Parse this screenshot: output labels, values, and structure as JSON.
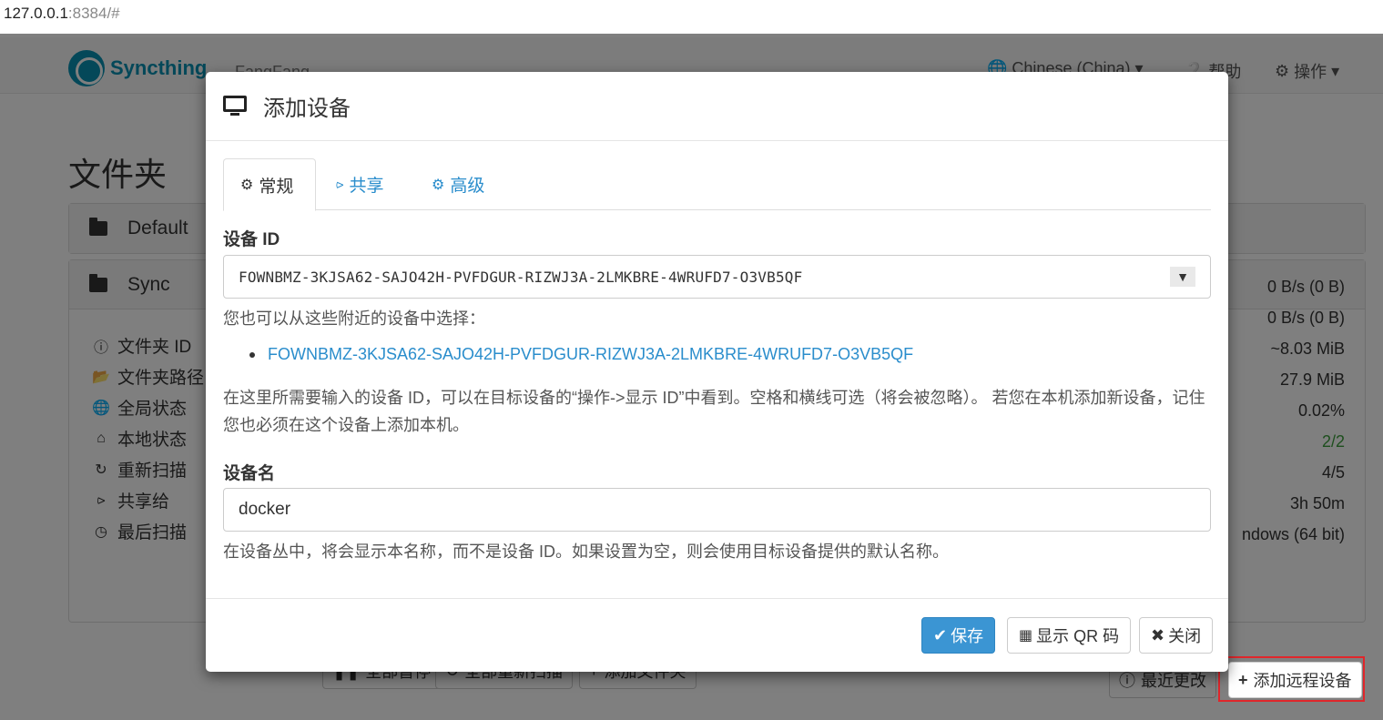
{
  "browser": {
    "url_host": "127.0.0.1",
    "url_rest": ":8384/#"
  },
  "navbar": {
    "brand": "Syncthing",
    "device_name": "FangFang",
    "language": "Chinese (China)",
    "help": "帮助",
    "actions": "操作"
  },
  "page": {
    "title": "文件夹",
    "folders": [
      {
        "name": "Default"
      },
      {
        "name": "Sync"
      }
    ],
    "info_labels": [
      "文件夹 ID",
      "文件夹路径",
      "全局状态",
      "本地状态",
      "重新扫描",
      "共享给",
      "最后扫描"
    ],
    "info_values": [
      "0 B/s (0 B)",
      "0 B/s (0 B)",
      "~8.03 MiB",
      "27.9 MiB",
      "0.02%",
      "2/2",
      "4/5",
      "3h 50m",
      "ndows (64 bit)"
    ],
    "buttons": {
      "pause_all": "全部暂停",
      "rescan_all": "全部重新扫描",
      "add_folder": "添加文件夹",
      "recent_changes": "最近更改",
      "add_remote_device": "添加远程设备"
    },
    "status_green": "#3c9e3c"
  },
  "modal": {
    "title": "添加设备",
    "tabs": [
      "常规",
      "共享",
      "高级"
    ],
    "device_id_label": "设备 ID",
    "device_id_value": "FOWNBMZ-3KJSA62-SAJO42H-PVFDGUR-RIZWJ3A-2LMKBRE-4WRUFD7-O3VB5QF",
    "nearby_hint": "您也可以从这些附近的设备中选择：",
    "nearby_devices": [
      "FOWNBMZ-3KJSA62-SAJO42H-PVFDGUR-RIZWJ3A-2LMKBRE-4WRUFD7-O3VB5QF"
    ],
    "id_help": "在这里所需要输入的设备 ID，可以在目标设备的“操作->显示 ID”中看到。空格和横线可选（将会被忽略）。 若您在本机添加新设备，记住您也必须在这个设备上添加本机。",
    "name_label": "设备名",
    "name_value": "docker",
    "name_help": "在设备丛中，将会显示本名称，而不是设备 ID。如果设置为空，则会使用目标设备提供的默认名称。",
    "save": "保存",
    "show_qr": "显示 QR 码",
    "close": "关闭"
  },
  "colors": {
    "accent": "#2a8dcc",
    "primary_button": "#3b95d3",
    "highlight_box": "#e0262b",
    "brand": "#0891b2"
  }
}
